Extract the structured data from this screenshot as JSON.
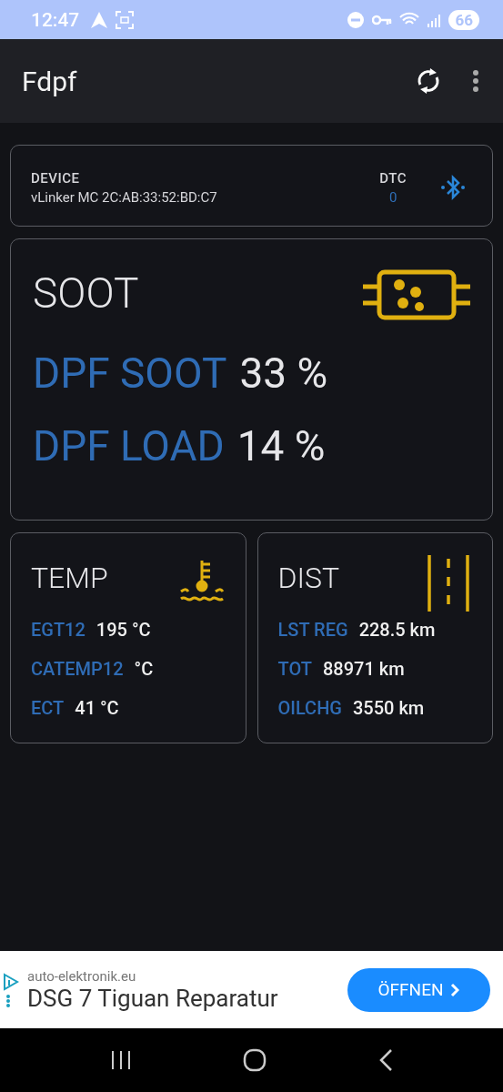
{
  "status_bar": {
    "time": "12:47",
    "battery": "66"
  },
  "app_bar": {
    "title": "Fdpf"
  },
  "device": {
    "label": "DEVICE",
    "name": "vLinker MC 2C:AB:33:52:BD:C7",
    "dtc_label": "DTC",
    "dtc_value": "0"
  },
  "soot": {
    "title": "SOOT",
    "rows": [
      {
        "label": "DPF SOOT",
        "value": "33 %"
      },
      {
        "label": "DPF LOAD",
        "value": "14 %"
      }
    ]
  },
  "panels": [
    {
      "kind": "temp",
      "title": "TEMP",
      "rows": [
        {
          "label": "EGT12",
          "value": "195 °C"
        },
        {
          "label": "CATEMP12",
          "value": "°C"
        },
        {
          "label": "ECT",
          "value": "41 °C"
        }
      ]
    },
    {
      "kind": "dist",
      "title": "DIST",
      "rows": [
        {
          "label": "LST REG",
          "value": "228.5 km"
        },
        {
          "label": "TOT",
          "value": "88971 km"
        },
        {
          "label": "OILCHG",
          "value": "3550 km"
        }
      ]
    }
  ],
  "ad": {
    "domain": "auto-elektronik.eu",
    "headline": "DSG 7 Tiguan Reparatur",
    "button": "ÖFFNEN"
  }
}
